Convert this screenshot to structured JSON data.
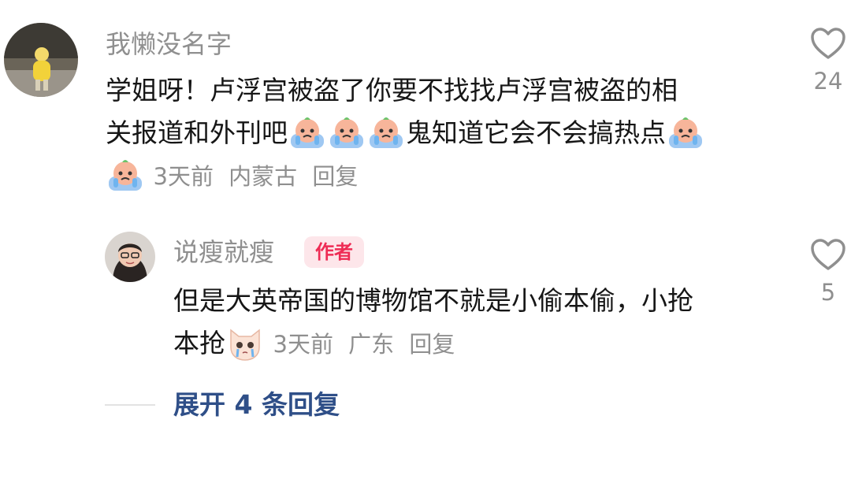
{
  "comments": [
    {
      "username": "我懒没名字",
      "text_lines": [
        "学姐呀！卢浮宫被盗了你要不找找卢浮宫被盗的相",
        "关报道和外刊吧",
        "鬼知道它会不会搞热点"
      ],
      "time": "3天前",
      "location": "内蒙古",
      "reply_label": "回复",
      "likes": "24",
      "icons": {
        "avatar": "child-avatar",
        "emoji": "crying-emoji",
        "like": "heart-outline-icon"
      }
    },
    {
      "username": "说瘦就瘦",
      "badge": "作者",
      "text_lines": [
        "但是大英帝国的博物馆不就是小偷本偷，小抢",
        "本抢"
      ],
      "time": "3天前",
      "location": "广东",
      "reply_label": "回复",
      "likes": "5",
      "icons": {
        "avatar": "woman-glasses-avatar",
        "emoji": "crying-cat-emoji",
        "like": "heart-outline-icon"
      }
    }
  ],
  "expand_replies": "展开 4 条回复",
  "colors": {
    "username": "#8f8f8f",
    "text": "#161616",
    "badge_bg": "#fde6ea",
    "badge_text": "#ee2c55",
    "link": "#2f4f88"
  }
}
